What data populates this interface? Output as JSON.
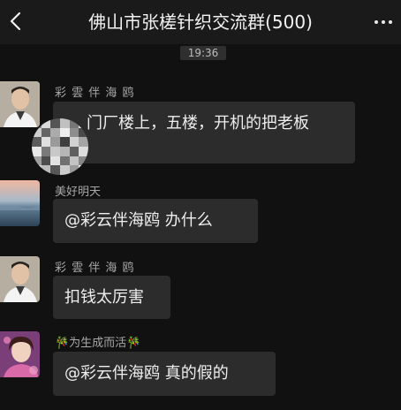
{
  "header": {
    "title": "佛山市张槎针织交流群(500)",
    "back_icon": "chevron-left-icon",
    "more_icon": "more-dots-icon"
  },
  "timestamp": "19:36",
  "messages": [
    {
      "sender": "彩 雲 伴 海 鸥",
      "text": "门厂楼上，五楼，开机的把老板"
    },
    {
      "sender": "美好明天",
      "text": "@彩云伴海鸥  办什么"
    },
    {
      "sender": "彩 雲 伴 海 鸥",
      "text": "扣钱太厉害"
    },
    {
      "sender": "🎋为生成而活🎋",
      "text": "@彩云伴海鸥  真的假的"
    }
  ],
  "colors": {
    "background": "#111111",
    "header_background": "#1a1a1a",
    "bubble": "#2c2c2c",
    "sender_name": "#a8a8a8"
  }
}
